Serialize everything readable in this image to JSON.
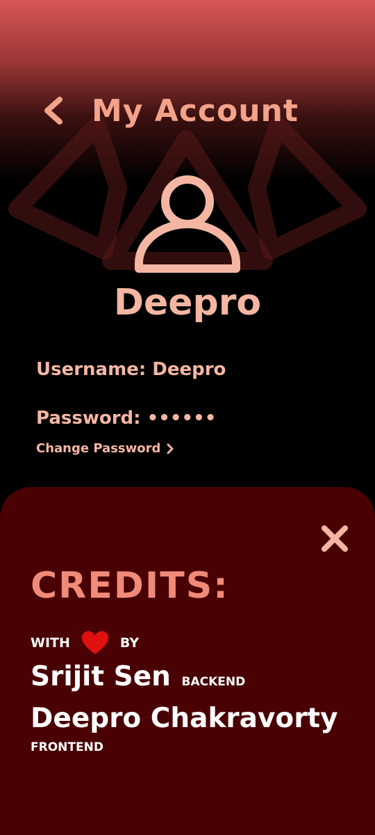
{
  "header": {
    "title": "My Account",
    "back_icon": "chevron-left-icon"
  },
  "profile": {
    "avatar_icon": "user-icon",
    "display_name": "Deepro",
    "username_line": "Username: Deepro",
    "password_line": "Password: ••••••",
    "change_password_label": "Change Password"
  },
  "credits": {
    "title": "CREDITS:",
    "with_label": "WITH",
    "by_label": "BY",
    "people": [
      {
        "name": "Srijit Sen",
        "role": "BACKEND"
      },
      {
        "name": "Deepro Chakravorty",
        "role": "FRONTEND"
      }
    ]
  },
  "colors": {
    "accent": "#f4b6a3",
    "title_accent": "#f08a79",
    "panel_bg": "#4a0103",
    "heart": "#e01010",
    "top_gradient": "#d85656"
  }
}
